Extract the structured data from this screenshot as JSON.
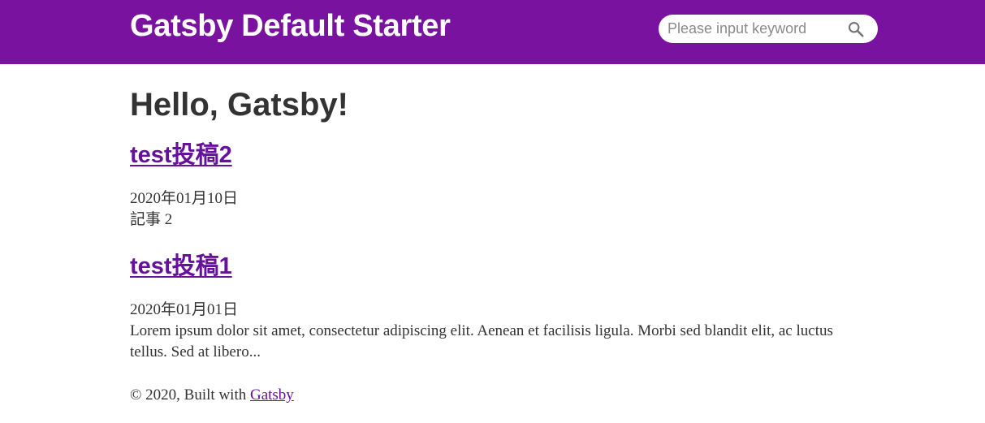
{
  "header": {
    "site_title": "Gatsby Default Starter",
    "search": {
      "placeholder": "Please input keyword",
      "value": "",
      "icon": "search-icon"
    },
    "background_color": "#7a12a0"
  },
  "main": {
    "title": "Hello, Gatsby!",
    "posts": [
      {
        "title": "test投稿2",
        "date": "2020年01月10日",
        "excerpt": "記事 2"
      },
      {
        "title": "test投稿1",
        "date": "2020年01月01日",
        "excerpt": "Lorem ipsum dolor sit amet, consectetur adipiscing elit. Aenean et facilisis ligula. Morbi sed blandit elit, ac luctus tellus. Sed at libero..."
      }
    ]
  },
  "footer": {
    "prefix": "© 2020, Built with",
    "link_text": "Gatsby"
  },
  "colors": {
    "brand": "#7a12a0",
    "link": "#66119a"
  }
}
